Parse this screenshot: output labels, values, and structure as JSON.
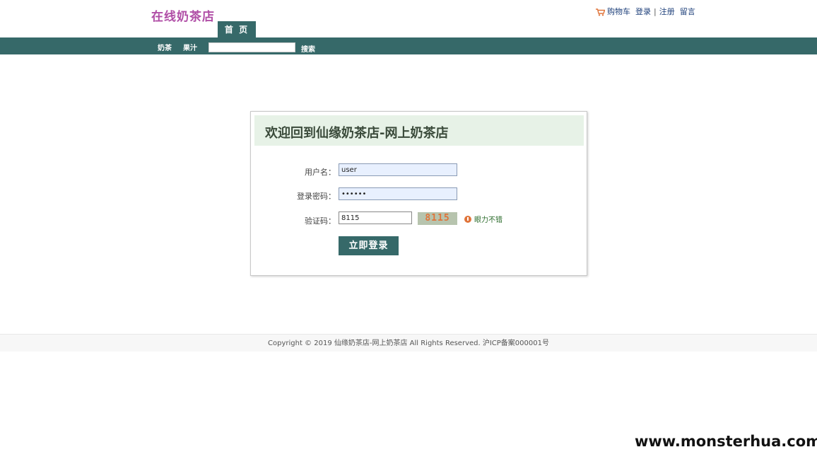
{
  "header": {
    "logo": "在线奶茶店",
    "cart_label": "购物车",
    "login_label": "登录",
    "separator": "|",
    "register_label": "注册",
    "message_label": "留言",
    "home_tab": "首 页"
  },
  "nav": {
    "items": [
      {
        "label": "奶茶"
      },
      {
        "label": "果汁"
      }
    ],
    "search_value": "",
    "search_button": "搜索"
  },
  "login": {
    "title": "欢迎回到仙缘奶茶店-网上奶茶店",
    "username_label": "用户名：",
    "username_value": "user",
    "password_label": "登录密码：",
    "password_value": "••••••",
    "captcha_label": "验证码：",
    "captcha_value": "8115",
    "captcha_image_text": "8115",
    "refresh_label": "眼力不错",
    "submit_label": "立即登录"
  },
  "footer": {
    "text": "Copyright © 2019 仙缘奶茶店-网上奶茶店 All Rights Reserved. 沪ICP备案000001号"
  },
  "watermark": "www.monsterhua.com",
  "colors": {
    "primary": "#366969",
    "logo": "#b04ea6",
    "title_bar": "#e7f2e7",
    "captcha_text": "#e0743a"
  }
}
